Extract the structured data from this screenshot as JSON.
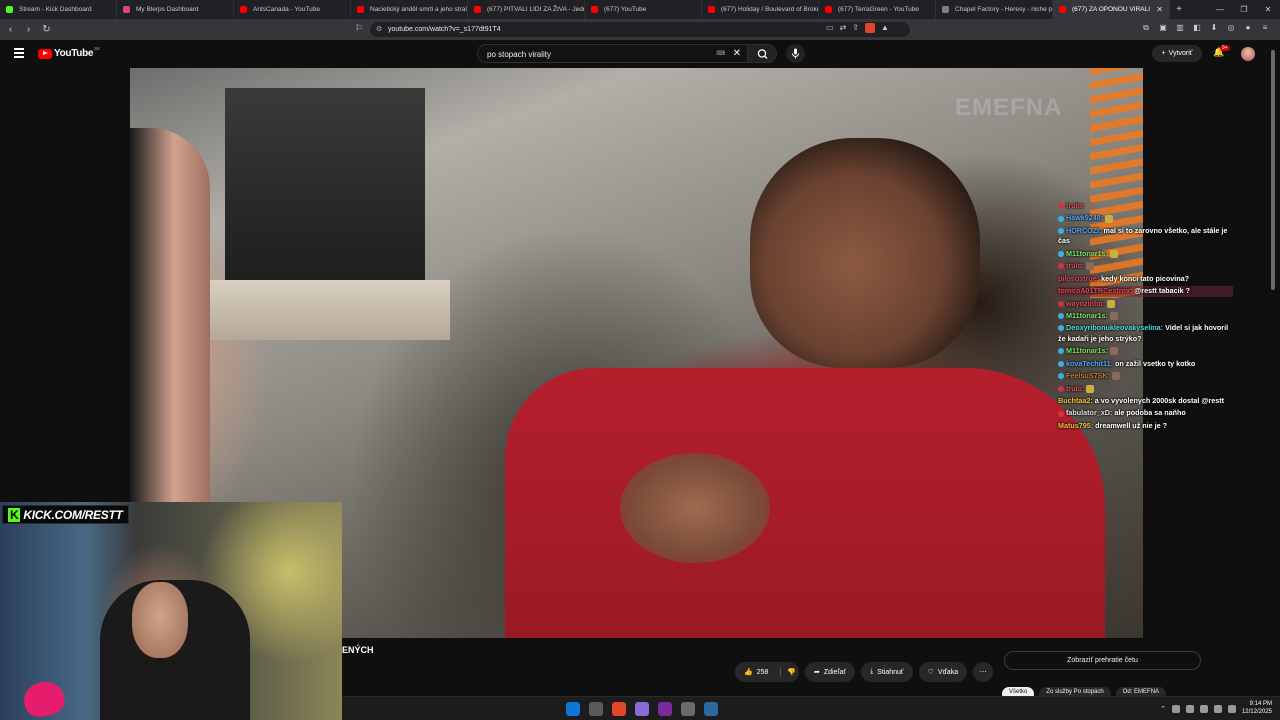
{
  "browser": {
    "tabs": [
      {
        "title": "Stream - Kick Dashboard",
        "favicon_color": "#53fc18"
      },
      {
        "title": "My Blerps Dashboard",
        "favicon_color": "#e0457b"
      },
      {
        "title": "AntsCanada - YouTube",
        "favicon_color": "#ff0000"
      },
      {
        "title": "Nacietický anděl smrti a jeho strašl",
        "favicon_color": "#ff0000"
      },
      {
        "title": "(677) PITVALI LIDI ZA ŽIVA - Jedno",
        "favicon_color": "#ff0000"
      },
      {
        "title": "(677) YouTube",
        "favicon_color": "#ff0000"
      },
      {
        "title": "(677) Holiday / Boulevard of Broke",
        "favicon_color": "#ff0000"
      },
      {
        "title": "(677) TerraGreen - YouTube",
        "favicon_color": "#ff0000"
      },
      {
        "title": "Chapel Factory - Heresy - niche pa",
        "favicon_color": "#808080"
      },
      {
        "title": "(677) ZA OPONOU VIRALI",
        "favicon_color": "#ff0000",
        "active": true
      }
    ],
    "new_tab": "+",
    "url": "youtube.com/watch?v=_s177dt91T4"
  },
  "youtube": {
    "logo": "YouTube",
    "region": "SK",
    "search_value": "po stopach virality",
    "create_label": "Vytvoriť",
    "notification_count": "9+"
  },
  "video": {
    "watermark": "EMEFNA",
    "title_fragment": "ENÝCH"
  },
  "chat": [
    {
      "user": "trulo:",
      "text": "",
      "color": "#e04a5a",
      "badge": "#d43040",
      "emote": true
    },
    {
      "user": "Hawk9248:",
      "text": "",
      "color": "#4fa8ff",
      "badge": "#3ab0e8",
      "emote": true
    },
    {
      "user": "HORCOZI:",
      "text": "mal si to zarovno všetko, ale stále je čas",
      "color": "#4fa8ff",
      "badge": "#3ab0e8",
      "emote": false
    },
    {
      "user": "M11tonar1s:",
      "text": "",
      "color": "#79e36a",
      "badge": "#3ab0e8",
      "emote": true
    },
    {
      "user": "trulo:",
      "text": "",
      "color": "#e04a5a",
      "badge": "#d43040",
      "emote": true
    },
    {
      "user": "pilosostrue:",
      "text": "kedy konci tato picovina?",
      "color": "#e04a5a",
      "badge": "",
      "emote": false
    },
    {
      "user": "tomiroA01TRCestrov:",
      "text": "@restt tabacik ?",
      "color": "#e04a5a",
      "badge": "",
      "emote": false,
      "highlight": true
    },
    {
      "user": "waynzinho:",
      "text": "",
      "color": "#e04a5a",
      "badge": "#d43040",
      "emote": true
    },
    {
      "user": "M11tonar1s:",
      "text": "",
      "color": "#79e36a",
      "badge": "#3ab0e8",
      "emote": true
    },
    {
      "user": "Deoxyribonukleovakyselina:",
      "text": "Videl si jak hovoril že kadaři je jeho strýko?",
      "color": "#4ae0e0",
      "badge": "#3ab0e8",
      "emote": false
    },
    {
      "user": "M11tonar1s:",
      "text": "",
      "color": "#79e36a",
      "badge": "#3ab0e8",
      "emote": true
    },
    {
      "user": "kovaTechit11:",
      "text": "on zažil vsetko ty kotko",
      "color": "#4fa8ff",
      "badge": "#3ab0e8",
      "emote": false
    },
    {
      "user": "FeelsuS7SK:",
      "text": "",
      "color": "#c07a3a",
      "badge": "#3ab0e8",
      "emote": true
    },
    {
      "user": "trulo:",
      "text": "",
      "color": "#e04a5a",
      "badge": "#d43040",
      "emote": true
    },
    {
      "user": "Buchtaa2:",
      "text": "a vo vyvolenych 2000sk dostal @restt",
      "color": "#f0c040",
      "badge": "",
      "emote": false
    },
    {
      "user": "fabulator_xD:",
      "text": "ale podoba sa naňho",
      "color": "#e0e0e0",
      "badge": "#d43040",
      "emote": false
    },
    {
      "user": "Matus795:",
      "text": "dreamwell už nie je ?",
      "color": "#f0c040",
      "badge": "",
      "emote": false
    }
  ],
  "webcam": {
    "kick_logo": "K",
    "kick_url": "KICK.COM/RESTT"
  },
  "actions": {
    "like_count": "258",
    "share": "Zdieľať",
    "download": "Stiahnuť",
    "thanks": "Vďaka"
  },
  "live_chat": {
    "replay_label": "Zobraziť prehratie četu"
  },
  "chips": [
    {
      "label": "Všetko",
      "selected": true
    },
    {
      "label": "Zo služby Po stopách",
      "selected": false
    },
    {
      "label": "Od: EMEFNA",
      "selected": false
    }
  ],
  "taskbar": {
    "time": "9:14 PM",
    "date": "12/12/2025",
    "app_colors": [
      "#0a78d4",
      "#5a5a5a",
      "#e0462c",
      "#8a6ad8",
      "#7a2a9a",
      "#6a6a6a",
      "#2a6aa0"
    ]
  }
}
